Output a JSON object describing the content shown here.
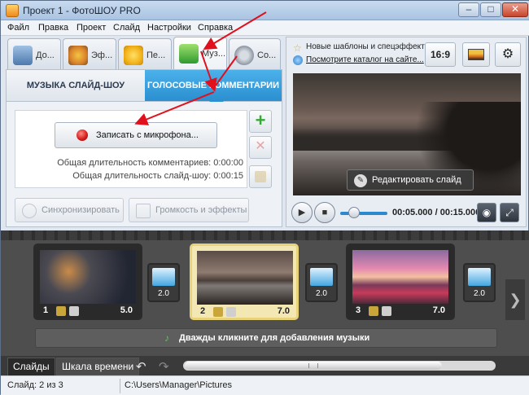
{
  "window": {
    "title": "Проект 1 - ФотоШОУ PRO",
    "minimize_glyph": "–",
    "maximize_glyph": "□",
    "close_glyph": "✕"
  },
  "menu": [
    "Файл",
    "Правка",
    "Проект",
    "Слайд",
    "Настройки",
    "Справка"
  ],
  "tabs": [
    {
      "label": "До...",
      "icon": "camera-icon"
    },
    {
      "label": "Эф...",
      "icon": "palette-icon"
    },
    {
      "label": "Пе...",
      "icon": "star-icon"
    },
    {
      "label": "Муз...",
      "icon": "music-note-icon",
      "active": true
    },
    {
      "label": "Со...",
      "icon": "film-reel-icon"
    }
  ],
  "subtabs": {
    "slideshow_music": "МУЗЫКА СЛАЙД-ШОУ",
    "voice_comments": "ГОЛОСОВЫЕ КОММЕНТАРИИ"
  },
  "voice_panel": {
    "record_button": "Записать с микрофона...",
    "total_comments_label": "Общая длительность комментариев: 0:00:00",
    "total_slideshow_label": "Общая длительность слайд-шоу: 0:00:15",
    "add_glyph": "+",
    "delete_glyph": "✕",
    "sync_button": "Синхронизировать",
    "volume_button": "Громкость и эффекты"
  },
  "right_panel": {
    "news_1": "Новые шаблоны и спецэффекты",
    "news_2": "Посмотрите каталог на сайте...",
    "aspect_button": "16:9",
    "edit_slide_button": "Редактировать слайд",
    "time_current": "00:05.000",
    "time_total": "00:15.000",
    "time_display": "00:05.000 / 00:15.000",
    "play_glyph": "▶",
    "stop_glyph": "■",
    "snapshot_glyph": "◉",
    "fullscreen_glyph": "⤢",
    "pencil_glyph": "✎"
  },
  "slides": [
    {
      "number": "1",
      "duration": "5.0"
    },
    {
      "number": "2",
      "duration": "7.0",
      "selected": true
    },
    {
      "number": "3",
      "duration": "7.0"
    }
  ],
  "transitions": [
    {
      "duration": "2.0"
    },
    {
      "duration": "2.0"
    },
    {
      "duration": "2.0"
    }
  ],
  "timeline": {
    "music_hint": "Дважды кликните для добавления музыки",
    "music_glyph": "♪",
    "next_glyph": "❯",
    "undo_glyph": "↶",
    "redo_glyph": "↷"
  },
  "bottom_tabs": {
    "slides": "Слайды",
    "timeline": "Шкала времени"
  },
  "status": {
    "slide": "Слайд: 2 из 3",
    "path": "C:\\Users\\Manager\\Pictures"
  },
  "colors": {
    "accent_blue": "#2b8fd0",
    "annotation_red": "#e0101c",
    "record_red": "#d21818",
    "add_green": "#35a835"
  }
}
